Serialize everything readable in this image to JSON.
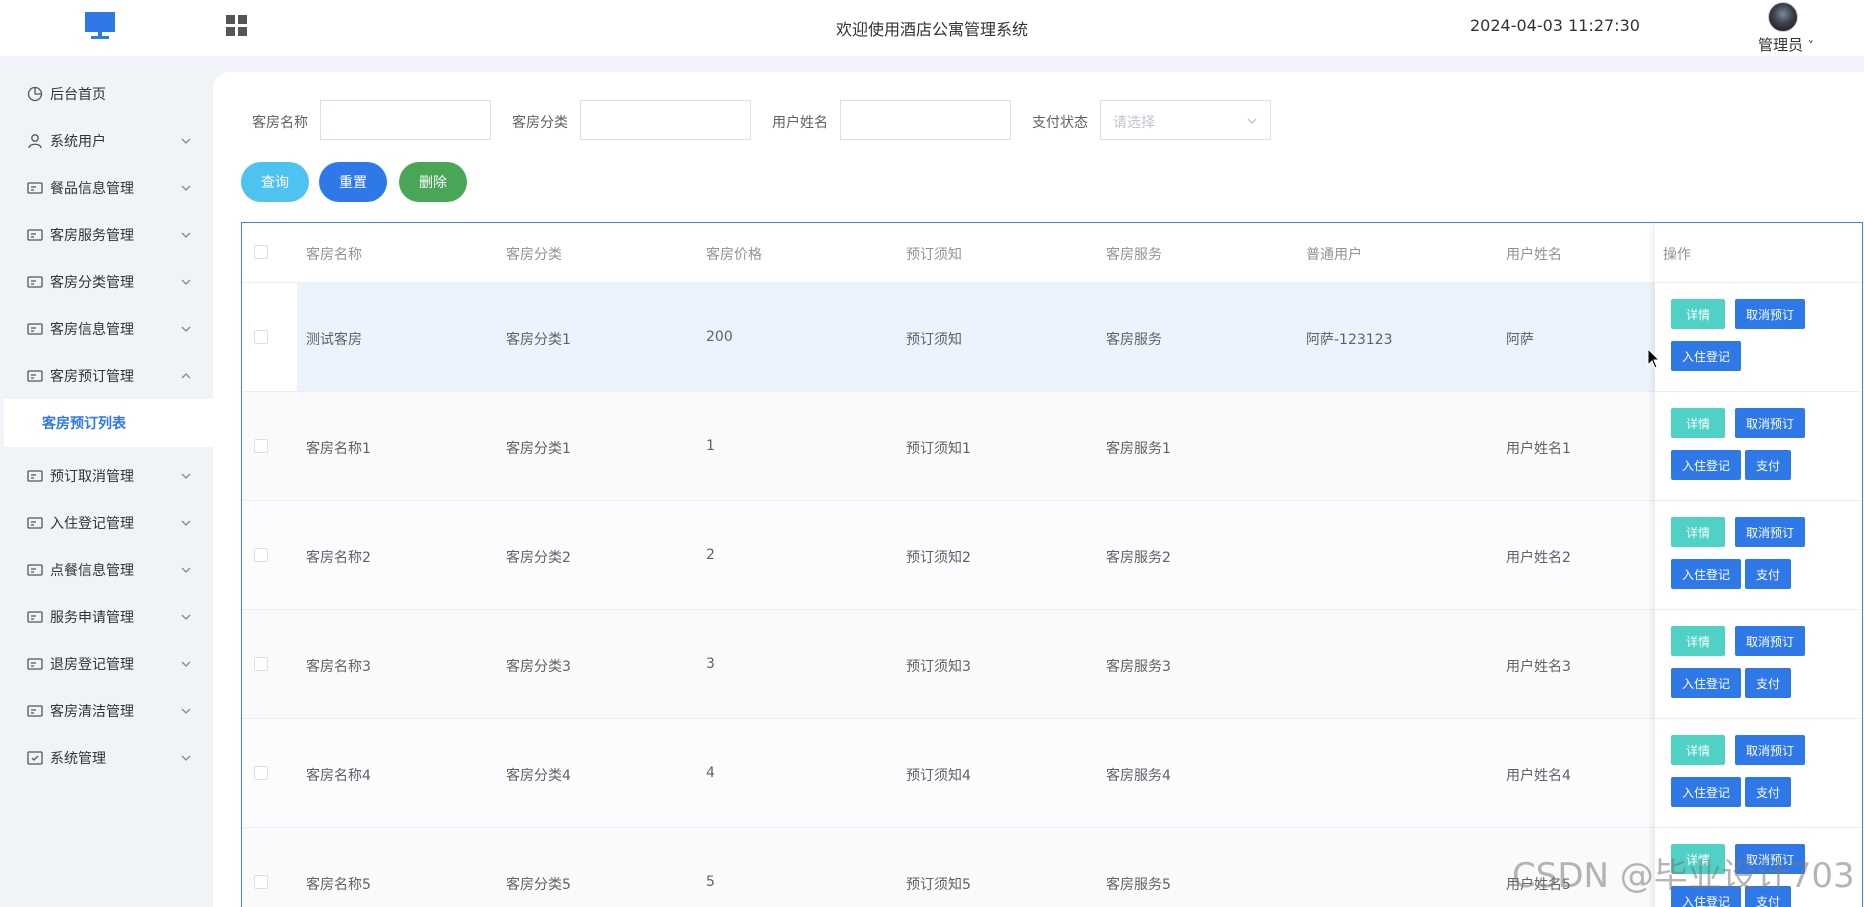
{
  "header": {
    "welcome": "欢迎使用酒店公寓管理系统",
    "datetime": "2024-04-03 11:27:30",
    "user_label": "管理员",
    "user_caret": "˅",
    "logo_icon": "monitor-icon",
    "menu_toggle_icon": "grid-icon"
  },
  "sidebar": {
    "items": [
      {
        "label": "后台首页",
        "icon": "clock-icon"
      },
      {
        "label": "系统用户",
        "icon": "user-icon"
      },
      {
        "label": "餐品信息管理",
        "icon": "card-icon"
      },
      {
        "label": "客房服务管理",
        "icon": "card-icon"
      },
      {
        "label": "客房分类管理",
        "icon": "card-icon"
      },
      {
        "label": "客房信息管理",
        "icon": "card-icon"
      },
      {
        "label": "客房预订管理",
        "icon": "card-icon",
        "expanded": true
      },
      {
        "label": "预订取消管理",
        "icon": "card-icon"
      },
      {
        "label": "入住登记管理",
        "icon": "card-icon"
      },
      {
        "label": "点餐信息管理",
        "icon": "card-icon"
      },
      {
        "label": "服务申请管理",
        "icon": "card-icon"
      },
      {
        "label": "退房登记管理",
        "icon": "card-icon"
      },
      {
        "label": "客房清洁管理",
        "icon": "card-icon"
      },
      {
        "label": "系统管理",
        "icon": "settings-box-icon"
      }
    ],
    "active_sub": "客房预订列表"
  },
  "filters": {
    "room_name_label": "客房名称",
    "room_name_value": "",
    "room_cat_label": "客房分类",
    "room_cat_value": "",
    "username_label": "用户姓名",
    "username_value": "",
    "pay_status_label": "支付状态",
    "pay_status_placeholder": "请选择"
  },
  "actions": {
    "query": "查询",
    "reset": "重置",
    "delete": "删除"
  },
  "colors": {
    "primary": "#2f78e8",
    "query_btn": "#4ec3f0",
    "delete_btn": "#4aa657",
    "detail_btn": "#4fd1c5",
    "row_hover": "#ecf3fc"
  },
  "table": {
    "headers": [
      "客房名称",
      "客房分类",
      "客房价格",
      "预订须知",
      "客房服务",
      "普通用户",
      "用户姓名",
      "操作"
    ],
    "rows": [
      {
        "name": "测试客房",
        "category": "客房分类1",
        "price": "200",
        "notice": "预订须知",
        "service": "客房服务",
        "user": "阿萨-123123",
        "username": "阿萨"
      },
      {
        "name": "客房名称1",
        "category": "客房分类1",
        "price": "1",
        "notice": "预订须知1",
        "service": "客房服务1",
        "user": "",
        "username": "用户姓名1"
      },
      {
        "name": "客房名称2",
        "category": "客房分类2",
        "price": "2",
        "notice": "预订须知2",
        "service": "客房服务2",
        "user": "",
        "username": "用户姓名2"
      },
      {
        "name": "客房名称3",
        "category": "客房分类3",
        "price": "3",
        "notice": "预订须知3",
        "service": "客房服务3",
        "user": "",
        "username": "用户姓名3"
      },
      {
        "name": "客房名称4",
        "category": "客房分类4",
        "price": "4",
        "notice": "预订须知4",
        "service": "客房服务4",
        "user": "",
        "username": "用户姓名4"
      },
      {
        "name": "客房名称5",
        "category": "客房分类5",
        "price": "5",
        "notice": "预订须知5",
        "service": "客房服务5",
        "user": "",
        "username": "用户姓名5"
      }
    ],
    "ops": {
      "detail": "详情",
      "cancel": "取消预订",
      "checkin": "入住登记",
      "pay": "支付"
    }
  },
  "watermark": "CSDN @毕业设计703"
}
